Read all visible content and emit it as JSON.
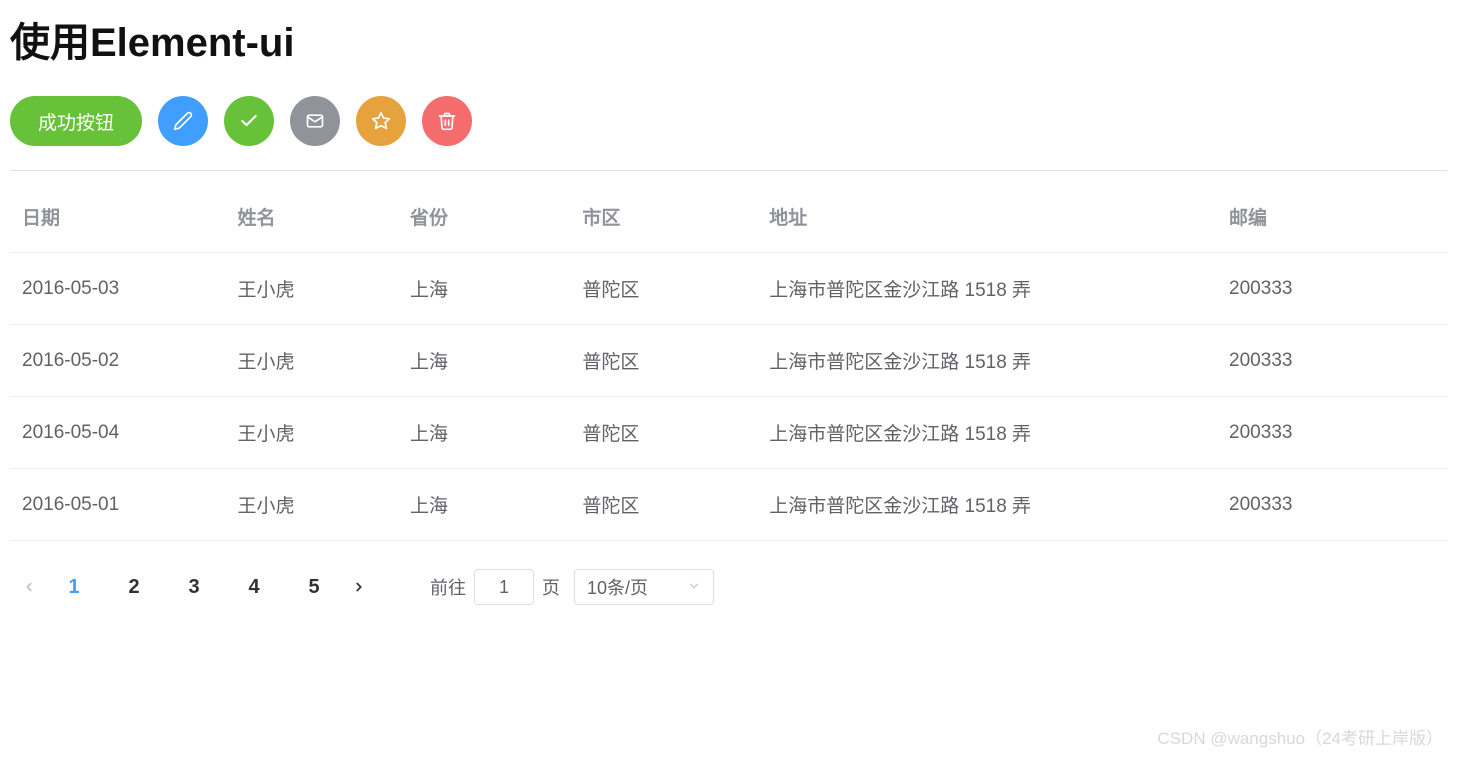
{
  "title": "使用Element-ui",
  "buttons": {
    "success_label": "成功按钮"
  },
  "table": {
    "headers": [
      "日期",
      "姓名",
      "省份",
      "市区",
      "地址",
      "邮编"
    ],
    "rows": [
      {
        "date": "2016-05-03",
        "name": "王小虎",
        "province": "上海",
        "district": "普陀区",
        "address": "上海市普陀区金沙江路 1518 弄",
        "zip": "200333"
      },
      {
        "date": "2016-05-02",
        "name": "王小虎",
        "province": "上海",
        "district": "普陀区",
        "address": "上海市普陀区金沙江路 1518 弄",
        "zip": "200333"
      },
      {
        "date": "2016-05-04",
        "name": "王小虎",
        "province": "上海",
        "district": "普陀区",
        "address": "上海市普陀区金沙江路 1518 弄",
        "zip": "200333"
      },
      {
        "date": "2016-05-01",
        "name": "王小虎",
        "province": "上海",
        "district": "普陀区",
        "address": "上海市普陀区金沙江路 1518 弄",
        "zip": "200333"
      }
    ]
  },
  "pagination": {
    "pages": [
      "1",
      "2",
      "3",
      "4",
      "5"
    ],
    "current": "1",
    "jumper_prefix": "前往",
    "jumper_suffix": "页",
    "jumper_value": "1",
    "page_size_label": "10条/页"
  },
  "watermark": "CSDN @wangshuo（24考研上岸版）"
}
